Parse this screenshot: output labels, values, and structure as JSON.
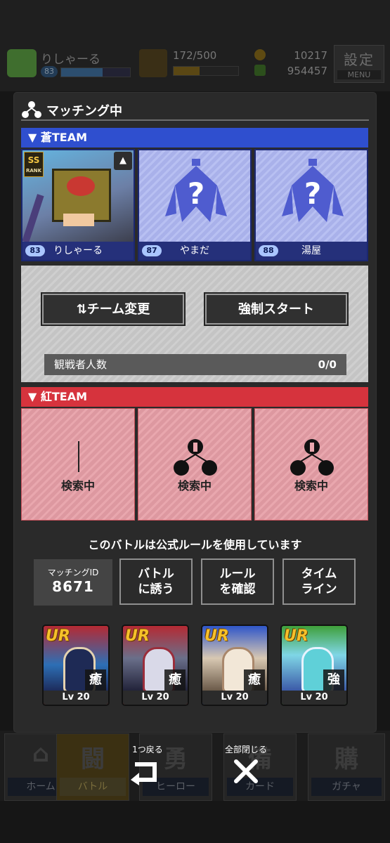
{
  "status_bar": {
    "player_name": "りしゃーる",
    "player_level": "83",
    "stamina": "172/500",
    "currency_1": "10217",
    "currency_2": "954457",
    "menu_label": "設定",
    "menu_sub": "MENU"
  },
  "dialog": {
    "title": "マッチング中",
    "blue_team": {
      "label": "▼ 蒼TEAM",
      "members": [
        {
          "name": "りしゃーる",
          "level": "83",
          "rank": "SS",
          "rank_sub": "RANK"
        },
        {
          "name": "やまだ",
          "level": "87"
        },
        {
          "name": "湯屋",
          "level": "88"
        }
      ]
    },
    "controls": {
      "team_change": "⇅チーム変更",
      "force_start": "強制スタート",
      "spectators_label": "観戦者人数",
      "spectators_value": "0/0"
    },
    "red_team": {
      "label": "▼ 紅TEAM",
      "slots": [
        "検索中",
        "検索中",
        "検索中"
      ]
    },
    "rule_text": "このバトルは公式ルールを使用しています",
    "matching_id_label": "マッチングID",
    "matching_id": "8671",
    "buttons": {
      "invite_1": "バトル",
      "invite_2": "に誘う",
      "rule_1": "ルール",
      "rule_2": "を確認",
      "timeline_1": "タイム",
      "timeline_2": "ライン"
    },
    "cards": [
      {
        "rarity": "UR",
        "type": "癒",
        "level": "Lv 20"
      },
      {
        "rarity": "UR",
        "type": "癒",
        "level": "Lv 20"
      },
      {
        "rarity": "UR",
        "type": "癒",
        "level": "Lv 20"
      },
      {
        "rarity": "UR",
        "type": "強",
        "level": "Lv 20"
      }
    ]
  },
  "bottom_nav": {
    "tabs": [
      "ホーム",
      "バトル",
      "ヒーロー",
      "カード",
      "ガチャ"
    ],
    "back_label": "1つ戻る",
    "close_all_label": "全部閉じる"
  }
}
